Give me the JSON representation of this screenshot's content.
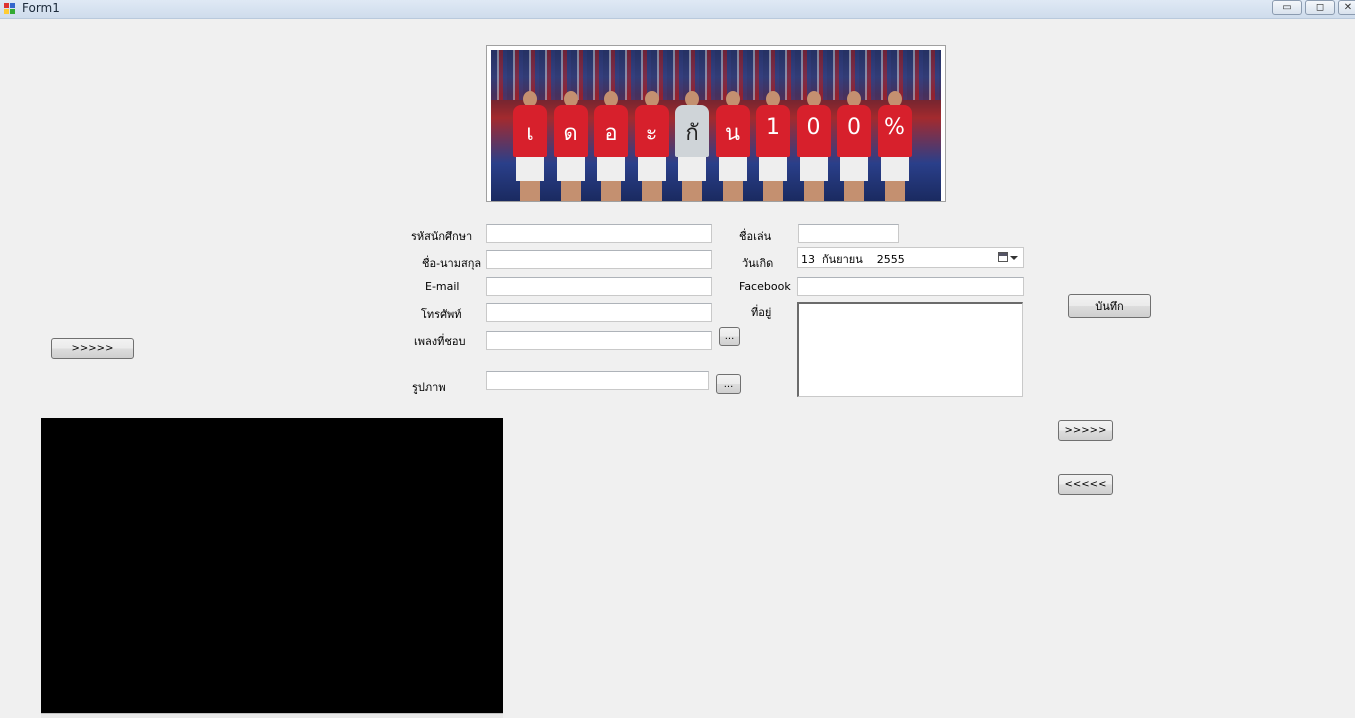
{
  "window": {
    "title": "Form1",
    "controls": {
      "minimize": "▭",
      "maximize": "◻",
      "close": "✕"
    }
  },
  "banner": {
    "shirt_letters": [
      "เ",
      "ด",
      "อ",
      "ะ",
      "กั",
      "น",
      "1",
      "0",
      "0",
      "%"
    ]
  },
  "form": {
    "student_id_label": "รหัสนักศึกษา",
    "fullname_label": "ชื่อ-นามสกุล",
    "email_label": "E-mail",
    "phone_label": "โทรศัพท์",
    "song_label": "เพลงที่ชอบ",
    "picture_label": "รูปภาพ",
    "nickname_label": "ชื่อเล่น",
    "birthday_label": "วันเกิด",
    "facebook_label": "Facebook",
    "address_label": "ที่อยู่",
    "birthday_value": "13  กันยายน    2555",
    "browse_song_label": "...",
    "browse_picture_label": "...",
    "save_label": "บันทึก"
  },
  "buttons": {
    "left_next_label": ">>>>>",
    "right_next_label": ">>>>>",
    "right_prev_label": "<<<<<"
  },
  "colors": {
    "shirt": "#d7202c",
    "window_bg": "#f0f0f0"
  }
}
